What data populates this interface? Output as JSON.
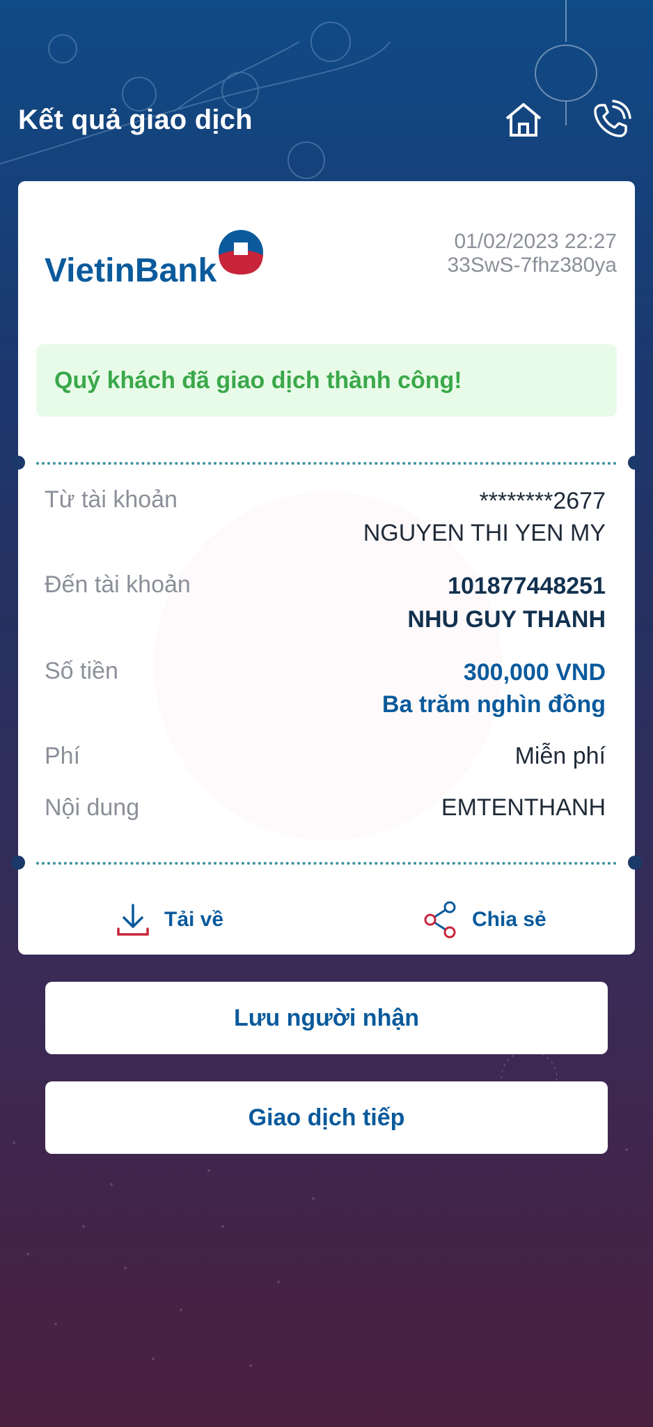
{
  "header": {
    "title": "Kết quả giao dịch"
  },
  "icons": {
    "home": "home-icon",
    "call": "phone-call-icon",
    "download": "download-icon",
    "share": "share-icon"
  },
  "brand": {
    "name": "VietinBank",
    "accent": "#0a5a9c",
    "red": "#c8243a"
  },
  "receipt": {
    "datetime": "01/02/2023 22:27",
    "ref": "33SwS-7fhz380ya",
    "success": "Quý khách đã giao dịch thành công!",
    "from_label": "Từ tài khoản",
    "from_account": "********2677",
    "from_name": "NGUYEN THI YEN MY",
    "to_label": "Đến tài khoản",
    "to_account": "101877448251",
    "to_name": "NHU GUY THANH",
    "amount_label": "Số tiền",
    "amount": "300,000 VND",
    "amount_words": "Ba trăm nghìn đồng",
    "fee_label": "Phí",
    "fee": "Miễn phí",
    "content_label": "Nội dung",
    "content": "EMTENTHANH"
  },
  "actions": {
    "download": "Tải về",
    "share": "Chia sẻ"
  },
  "buttons": {
    "save_recipient": "Lưu người nhận",
    "continue": "Giao dịch tiếp"
  }
}
